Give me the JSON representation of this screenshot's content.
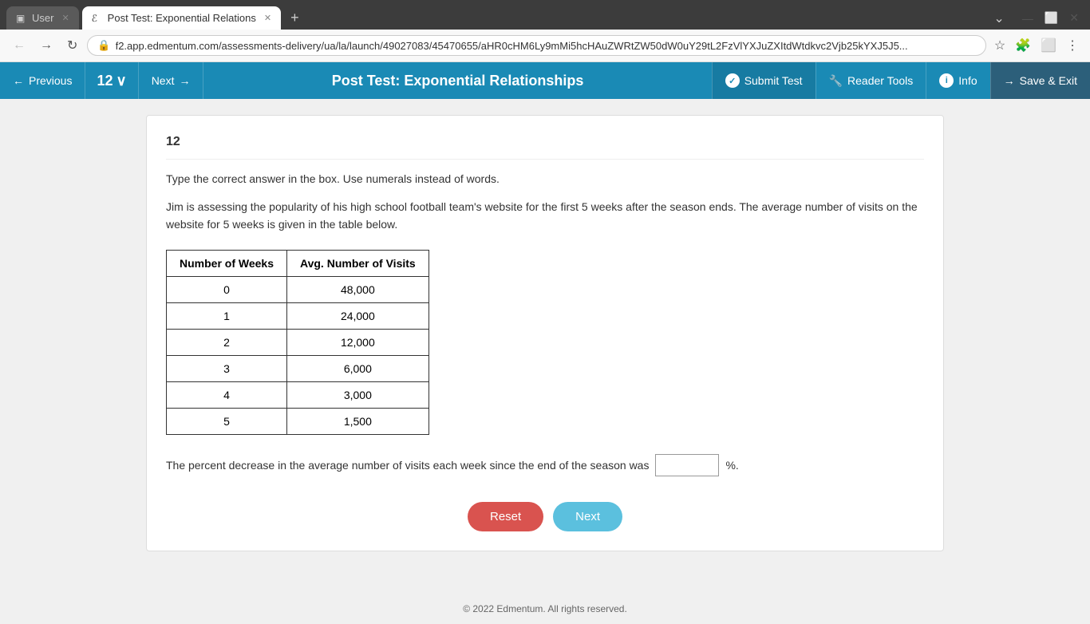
{
  "browser": {
    "tabs": [
      {
        "id": "tab1",
        "favicon": "▣",
        "label": "User",
        "active": false
      },
      {
        "id": "tab2",
        "favicon": "ℰ",
        "label": "Post Test: Exponential Relations",
        "active": true
      }
    ],
    "new_tab_label": "+",
    "address": "f2.app.edmentum.com/assessments-delivery/ua/la/launch/49027083/45470655/aHR0cHM6Ly9mMi5hcHAuZWRtZW50dW0uY29tL2FzVlYXJuZXItdWtdkvc2Vjb25kYXJ5J5...",
    "nav": {
      "back_label": "←",
      "forward_label": "→",
      "refresh_label": "↻",
      "lock_icon": "🔒"
    }
  },
  "navbar": {
    "previous_label": "Previous",
    "question_number": "12",
    "chevron": "∨",
    "next_label": "Next",
    "test_title": "Post Test: Exponential Relationships",
    "submit_label": "Submit Test",
    "reader_tools_label": "Reader Tools",
    "info_label": "Info",
    "save_exit_label": "Save & Exit"
  },
  "question": {
    "number": "12",
    "instruction": "Type the correct answer in the box. Use numerals instead of words.",
    "body": "Jim is assessing the popularity of his high school football team's website for the first 5 weeks after the season ends. The average number of visits on the website for 5 weeks is given in the table below.",
    "table": {
      "headers": [
        "Number of Weeks",
        "Avg. Number of Visits"
      ],
      "rows": [
        [
          "0",
          "48,000"
        ],
        [
          "1",
          "24,000"
        ],
        [
          "2",
          "12,000"
        ],
        [
          "3",
          "6,000"
        ],
        [
          "4",
          "3,000"
        ],
        [
          "5",
          "1,500"
        ]
      ]
    },
    "answer_prefix": "The percent decrease in the average number of visits each week since the end of the season was",
    "answer_suffix": "%.",
    "answer_value": ""
  },
  "buttons": {
    "reset_label": "Reset",
    "next_label": "Next"
  },
  "footer": {
    "copyright": "© 2022 Edmentum. All rights reserved."
  }
}
